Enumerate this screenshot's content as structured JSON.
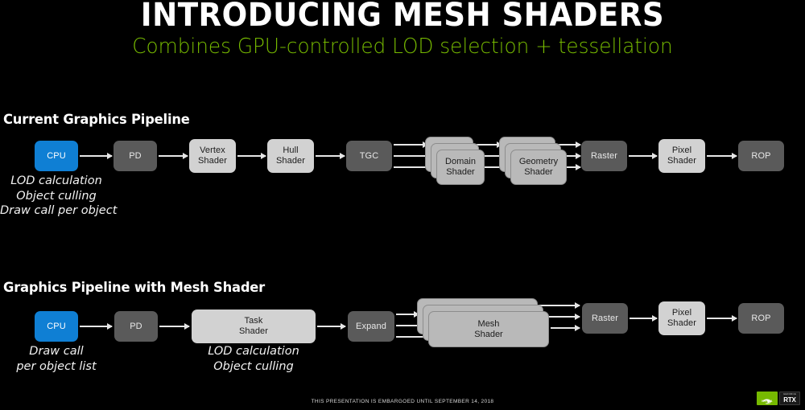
{
  "header": {
    "title": "INTRODUCING MESH SHADERS",
    "subtitle": "Combines GPU-controlled LOD selection + tessellation",
    "accent_color": "#76b900",
    "title_color": "#ffffff"
  },
  "sections": [
    {
      "id": "current",
      "heading": "Current Graphics Pipeline"
    },
    {
      "id": "mesh",
      "heading": "Graphics Pipeline with Mesh Shader"
    }
  ],
  "colors": {
    "cpu_blue": "#0f7fd4",
    "dark_gray": "#5a5a5a",
    "light_gray": "#d2d2d2",
    "mid_gray": "#b9b9b9",
    "background": "#000000",
    "arrow": "#e6e6e6"
  },
  "current_pipeline": {
    "nodes": [
      {
        "id": "cpu",
        "label": "CPU",
        "style": "blue",
        "stacked": false
      },
      {
        "id": "pd",
        "label": "PD",
        "style": "dark",
        "stacked": false
      },
      {
        "id": "vertex",
        "label": "Vertex\nShader",
        "style": "light",
        "stacked": false
      },
      {
        "id": "hull",
        "label": "Hull\nShader",
        "style": "light",
        "stacked": false
      },
      {
        "id": "tgc",
        "label": "TGC",
        "style": "dark",
        "stacked": false
      },
      {
        "id": "domain",
        "label": "Domain\nShader",
        "style": "mid",
        "stacked": true
      },
      {
        "id": "geometry",
        "label": "Geometry\nShader",
        "style": "mid",
        "stacked": true
      },
      {
        "id": "raster",
        "label": "Raster",
        "style": "dark",
        "stacked": false
      },
      {
        "id": "pixel",
        "label": "Pixel\nShader",
        "style": "light",
        "stacked": false
      },
      {
        "id": "rop",
        "label": "ROP",
        "style": "dark",
        "stacked": false
      }
    ],
    "node_labels": {
      "cpu": "CPU",
      "pd": "PD",
      "vertex_l1": "Vertex",
      "vertex_l2": "Shader",
      "hull_l1": "Hull",
      "hull_l2": "Shader",
      "tgc": "TGC",
      "domain_l1": "Domain",
      "domain_l2": "Shader",
      "geometry_l1": "Geometry",
      "geometry_l2": "Shader",
      "raster": "Raster",
      "pixel_l1": "Pixel",
      "pixel_l2": "Shader",
      "rop": "ROP"
    },
    "annotation": {
      "line1": "LOD calculation",
      "line2": "Object culling",
      "line3": "Draw call per object"
    }
  },
  "mesh_pipeline": {
    "nodes": [
      {
        "id": "cpu",
        "label": "CPU",
        "style": "blue",
        "stacked": false
      },
      {
        "id": "pd",
        "label": "PD",
        "style": "dark",
        "stacked": false
      },
      {
        "id": "task",
        "label": "Task\nShader",
        "style": "light",
        "stacked": false
      },
      {
        "id": "expand",
        "label": "Expand",
        "style": "dark",
        "stacked": false
      },
      {
        "id": "mesh",
        "label": "Mesh\nShader",
        "style": "mid",
        "stacked": true
      },
      {
        "id": "raster",
        "label": "Raster",
        "style": "dark",
        "stacked": false
      },
      {
        "id": "pixel",
        "label": "Pixel\nShader",
        "style": "light",
        "stacked": false
      },
      {
        "id": "rop",
        "label": "ROP",
        "style": "dark",
        "stacked": false
      }
    ],
    "node_labels": {
      "cpu": "CPU",
      "pd": "PD",
      "task_l1": "Task",
      "task_l2": "Shader",
      "expand": "Expand",
      "mesh_l1": "Mesh",
      "mesh_l2": "Shader",
      "raster": "Raster",
      "pixel_l1": "Pixel",
      "pixel_l2": "Shader",
      "rop": "ROP"
    },
    "annotation_cpu": {
      "line1": "Draw call",
      "line2": "per object list"
    },
    "annotation_task": {
      "line1": "LOD calculation",
      "line2": "Object culling"
    }
  },
  "footer": {
    "embargo": "THIS PRESENTATION IS EMBARGOED UNTIL SEPTEMBER 14, 2018",
    "nvidia_wordmark": "NVIDIA",
    "rtx_sub": "GEFORCE",
    "rtx_main": "RTX"
  }
}
